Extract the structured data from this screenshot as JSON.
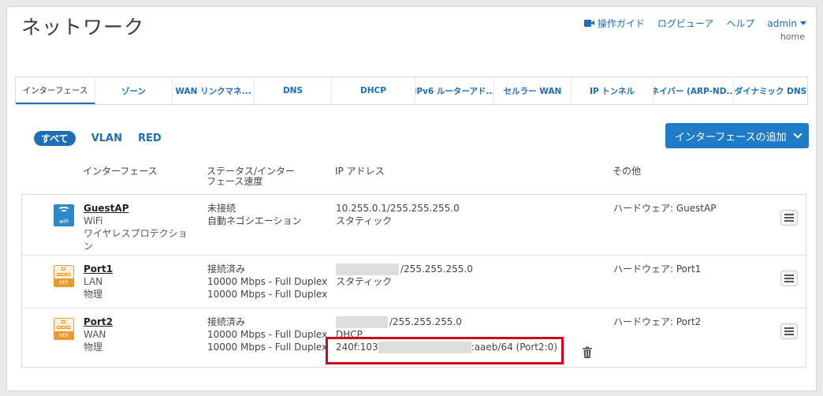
{
  "page": {
    "title": "ネットワーク"
  },
  "top_links": {
    "guide": "操作ガイド",
    "log_viewer": "ログビューア",
    "help": "ヘルプ",
    "user": "admin",
    "home": "home"
  },
  "tabs": [
    {
      "label": "インターフェース",
      "active": true
    },
    {
      "label": "ゾーン"
    },
    {
      "label": "WAN リンクマネ..."
    },
    {
      "label": "DNS"
    },
    {
      "label": "DHCP"
    },
    {
      "label": "IPv6 ルーターアド..."
    },
    {
      "label": "セルラー WAN"
    },
    {
      "label": "IP トンネル"
    },
    {
      "label": "ネイバー (ARP-ND..."
    },
    {
      "label": "ダイナミック DNS"
    }
  ],
  "filters": {
    "all": "すべて",
    "vlan": "VLAN",
    "red": "RED"
  },
  "add_button": "インターフェースの追加",
  "columns": {
    "interface": "インターフェース",
    "status_line1": "ステータス/インター",
    "status_line2": "フェース速度",
    "ip": "IP アドレス",
    "other": "その他"
  },
  "rows": [
    {
      "name": "GuestAP",
      "type": "WiFi",
      "subtype": "ワイヤレスプロテクショ",
      "subtype2": "ン",
      "icon_label": "wifi",
      "status1": "未接続",
      "status2": "自動ネゴシエーション",
      "ip1": "10.255.0.1/255.255.255.0",
      "ip2": "スタティック",
      "other": "ハードウェア: GuestAP"
    },
    {
      "name": "Port1",
      "type": "LAN",
      "subtype": "物理",
      "icon_label": "eth",
      "status1": "接続済み",
      "status2": "10000 Mbps - Full Duplex",
      "status3": "10000 Mbps - Full Duplex",
      "ip1": "/255.255.255.0",
      "ip2": "スタティック",
      "other": "ハードウェア: Port1"
    },
    {
      "name": "Port2",
      "type": "WAN",
      "subtype": "物理",
      "icon_label": "eth",
      "status1": "接続済み",
      "status2": "10000 Mbps - Full Duplex",
      "status3": "10000 Mbps - Full Duplex",
      "ip1": "/255.255.255.0",
      "ip2": "DHCP",
      "ipv6_prefix": "240f:103",
      "ipv6_suffix": ":aaeb/64 (Port2:0)",
      "other": "ハードウェア: Port2"
    }
  ],
  "colors": {
    "accent": "#1e6db5",
    "button": "#1f7bc8",
    "eth": "#e89a2c",
    "wifi": "#2f86c9",
    "highlight": "#d0021b"
  }
}
